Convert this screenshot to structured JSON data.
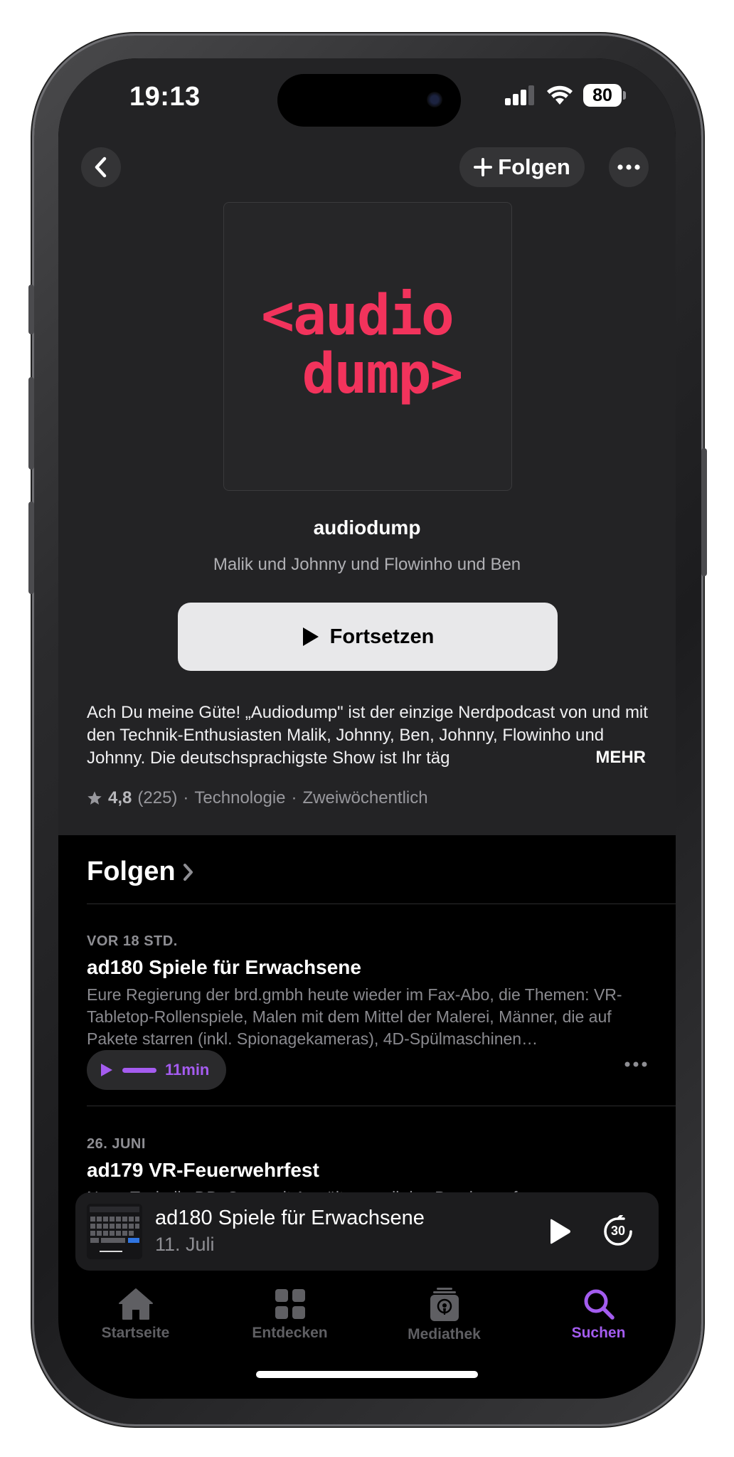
{
  "status_bar": {
    "time": "19:13",
    "battery": "80"
  },
  "nav": {
    "follow_label": "Folgen"
  },
  "podcast": {
    "cover_line1": "<audio",
    "cover_line2": "dump>",
    "title": "audiodump",
    "author": "Malik und Johnny und Flowinho und Ben",
    "resume_label": "Fortsetzen",
    "description": "Ach Du meine Güte! „Audiodump\" ist der einzige Nerdpodcast von und mit den Technik-Enthusiasten Malik, Johnny, Ben, Johnny, Flowinho und Johnny. Die deutschsprachigste Show ist Ihr täg",
    "more_label": "MEHR",
    "rating": "4,8",
    "rating_count": "(225)",
    "category": "Technologie",
    "frequency": "Zweiwöchentlich",
    "separator": "·"
  },
  "episodes_section": {
    "title": "Folgen"
  },
  "episodes": [
    {
      "date": "VOR 18 STD.",
      "title": "ad180 Spiele für Erwachsene",
      "description": "Eure Regierung der brd.gmbh heute wieder im Fax-Abo, die Themen: VR-Tabletop-Rollenspiele, Malen mit dem Mittel der Malerei, Männer, die auf Pakete starren (inkl. Spionagekameras), 4D-Spülmaschinen…",
      "remaining": "11min",
      "progress": 0.25
    },
    {
      "date": "26. JUNI",
      "title": "ad179 VR-Feuerwehrfest",
      "description": "Neue Technik: DDoSsen mit Anwälten, weil das Bundesverfassungs-"
    }
  ],
  "mini_player": {
    "title": "ad180 Spiele für Erwachsene",
    "subtitle": "11. Juli",
    "skip_label": "30"
  },
  "tabs": [
    {
      "label": "Startseite",
      "icon": "house-icon",
      "active": false
    },
    {
      "label": "Entdecken",
      "icon": "grid-icon",
      "active": false
    },
    {
      "label": "Mediathek",
      "icon": "library-icon",
      "active": false
    },
    {
      "label": "Suchen",
      "icon": "search-icon",
      "active": true
    }
  ],
  "colors": {
    "accent": "#a55cf0",
    "cover_red": "#f2335c",
    "background": "#000000",
    "header_bg": "#232325"
  }
}
